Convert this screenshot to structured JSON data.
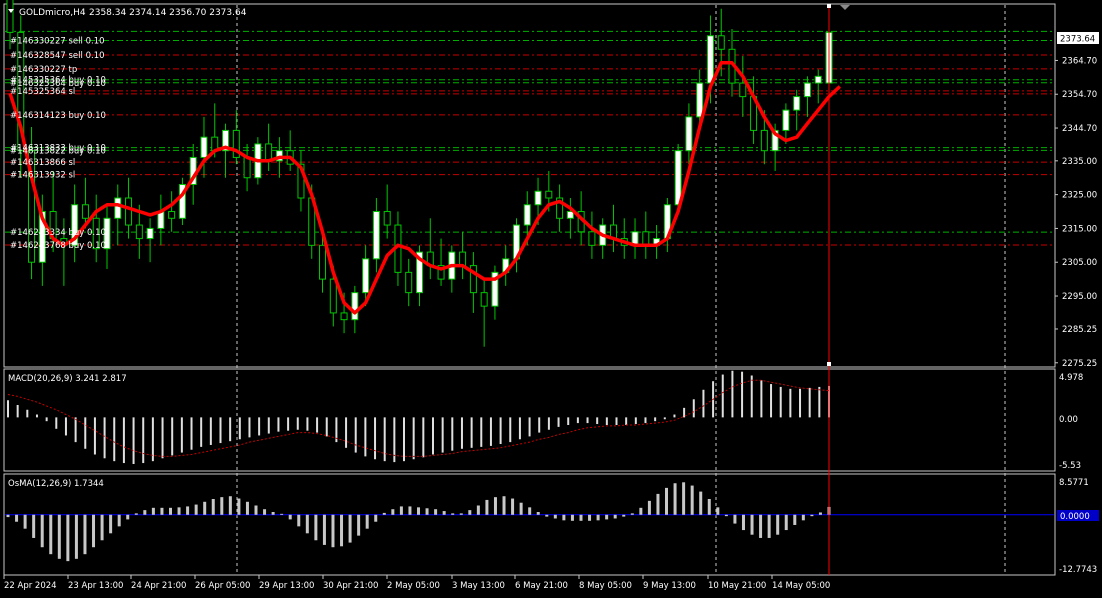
{
  "window": {
    "symbol_title": "GOLDmicro,H4",
    "ohlc": "2358.34 2374.14 2356.70 2373.64",
    "current_price_label": "2373.64",
    "colors": {
      "background": "#000000",
      "frame": "#c8c8c8",
      "grid": "#c8c8c8",
      "candle_bull": "#00c800",
      "candle_bull_body": "#ffffff",
      "candle_bear": "#00c800",
      "candle_bear_body": "#000000",
      "ma_line": "#ff0000",
      "sell_line": "#00b000",
      "buy_line": "#c80000",
      "macd_hist": "#e0e0e0",
      "macd_signal": "#c80000",
      "osma_hist": "#c8c8c8",
      "zero_line": "#0000ff",
      "current_time": "#ff0000"
    }
  },
  "price_axis": {
    "labels": [
      "2364.70",
      "2354.70",
      "2344.70",
      "2335.00",
      "2325.00",
      "2315.00",
      "2305.00",
      "2295.00",
      "2285.25",
      "2275.25"
    ],
    "values": [
      2364.7,
      2354.7,
      2344.7,
      2335.0,
      2325.0,
      2315.0,
      2305.0,
      2295.0,
      2285.25,
      2275.25
    ]
  },
  "time_axis": {
    "labels": [
      "22 Apr 2024",
      "23 Apr 13:00",
      "24 Apr 21:00",
      "26 Apr 05:00",
      "29 Apr 13:00",
      "30 Apr 21:00",
      "2 May 05:00",
      "3 May 13:00",
      "6 May 21:00",
      "8 May 05:00",
      "9 May 13:00",
      "10 May 21:00",
      "14 May 05:00"
    ]
  },
  "order_labels": [
    {
      "text": "#146330227 sell 0.10",
      "price": 2370.6
    },
    {
      "text": "#146328547 sell 0.10",
      "price": 2366.3
    },
    {
      "text": "#146330227 tp",
      "price": 2362.2
    },
    {
      "text": "#145325364 buy 0.10",
      "price": 2359.0
    },
    {
      "text": "#146325364 buy 0.10",
      "price": 2358.1
    },
    {
      "text": "#145325364 sl",
      "price": 2355.7
    },
    {
      "text": "#146314123 buy 0.10",
      "price": 2348.6
    },
    {
      "text": "#146313833 buy 0.10",
      "price": 2338.9
    },
    {
      "text": "#146313822 buy 0.10",
      "price": 2338.1
    },
    {
      "text": "#146313866 sl",
      "price": 2334.6
    },
    {
      "text": "#146313932 sl",
      "price": 2330.9
    },
    {
      "text": "#146243334 buy 0.10",
      "price": 2313.9
    },
    {
      "text": "#146243768 buy 0.10",
      "price": 2310.1
    }
  ],
  "order_lines": [
    {
      "price": 2373.3,
      "kind": "sell"
    },
    {
      "price": 2370.6,
      "kind": "sell"
    },
    {
      "price": 2366.3,
      "kind": "buy"
    },
    {
      "price": 2362.2,
      "kind": "buy"
    },
    {
      "price": 2359.0,
      "kind": "sell"
    },
    {
      "price": 2358.1,
      "kind": "sell"
    },
    {
      "price": 2355.7,
      "kind": "buy"
    },
    {
      "price": 2354.8,
      "kind": "buy"
    },
    {
      "price": 2348.6,
      "kind": "buy"
    },
    {
      "price": 2338.9,
      "kind": "sell"
    },
    {
      "price": 2338.1,
      "kind": "sell"
    },
    {
      "price": 2334.6,
      "kind": "buy"
    },
    {
      "price": 2330.9,
      "kind": "buy"
    },
    {
      "price": 2313.9,
      "kind": "sell"
    },
    {
      "price": 2310.1,
      "kind": "buy"
    }
  ],
  "macd_panel": {
    "title": "MACD(20,26,9) 3.241 2.817",
    "axis_labels": [
      "4.978",
      "0.00",
      "-5.53"
    ],
    "axis_values": [
      4.978,
      0.0,
      -5.53
    ],
    "hist": [
      1.8,
      1.3,
      0.8,
      0.3,
      -0.4,
      -1.2,
      -1.9,
      -2.6,
      -3.3,
      -3.9,
      -4.3,
      -4.6,
      -4.8,
      -4.9,
      -4.8,
      -4.6,
      -4.3,
      -4.0,
      -3.7,
      -3.4,
      -3.1,
      -2.9,
      -2.7,
      -2.5,
      -2.3,
      -2.1,
      -1.9,
      -1.7,
      -1.5,
      -1.4,
      -1.3,
      -1.4,
      -1.6,
      -2.0,
      -2.6,
      -3.2,
      -3.7,
      -4.1,
      -4.4,
      -4.6,
      -4.7,
      -4.6,
      -4.4,
      -4.2,
      -3.9,
      -3.7,
      -3.5,
      -3.3,
      -3.2,
      -3.1,
      -3.0,
      -2.8,
      -2.6,
      -2.3,
      -2.0,
      -1.6,
      -1.3,
      -1.0,
      -0.8,
      -0.6,
      -0.6,
      -0.7,
      -0.8,
      -0.8,
      -0.8,
      -0.7,
      -0.6,
      -0.4,
      -0.2,
      0.3,
      1.0,
      1.9,
      2.9,
      3.8,
      4.5,
      4.9,
      4.8,
      4.4,
      3.9,
      3.5,
      3.2,
      3.0,
      3.0,
      3.1,
      3.2,
      3.3
    ],
    "signal": [
      2.4,
      2.2,
      1.9,
      1.6,
      1.2,
      0.8,
      0.3,
      -0.2,
      -0.8,
      -1.4,
      -2.0,
      -2.6,
      -3.1,
      -3.5,
      -3.8,
      -4.0,
      -4.1,
      -4.1,
      -4.0,
      -3.9,
      -3.7,
      -3.5,
      -3.3,
      -3.1,
      -2.9,
      -2.6,
      -2.4,
      -2.2,
      -2.0,
      -1.8,
      -1.6,
      -1.6,
      -1.7,
      -1.9,
      -2.2,
      -2.5,
      -2.9,
      -3.2,
      -3.5,
      -3.8,
      -4.0,
      -4.1,
      -4.1,
      -4.1,
      -4.0,
      -3.9,
      -3.8,
      -3.6,
      -3.5,
      -3.4,
      -3.3,
      -3.2,
      -3.0,
      -2.8,
      -2.6,
      -2.3,
      -2.1,
      -1.8,
      -1.6,
      -1.3,
      -1.1,
      -1.0,
      -0.9,
      -0.9,
      -0.8,
      -0.8,
      -0.7,
      -0.6,
      -0.5,
      -0.3,
      0.1,
      0.6,
      1.2,
      1.9,
      2.6,
      3.2,
      3.6,
      3.9,
      3.9,
      3.7,
      3.5,
      3.3,
      3.1,
      3.0,
      2.9,
      2.8
    ]
  },
  "osma_panel": {
    "title": "OsMA(12,26,9) 1.7344",
    "axis_labels": [
      "8.5771",
      "0.0000",
      "-12.7743"
    ],
    "axis_values": [
      8.5771,
      0.0,
      -12.7743
    ],
    "hist": [
      -0.5,
      -1.5,
      -3.0,
      -5.0,
      -7.0,
      -8.5,
      -9.5,
      -10.0,
      -9.5,
      -8.5,
      -7.0,
      -5.5,
      -4.0,
      -2.5,
      -1.0,
      0.3,
      1.0,
      1.5,
      1.5,
      1.5,
      1.6,
      1.8,
      2.2,
      2.8,
      3.4,
      3.8,
      4.0,
      3.5,
      2.8,
      2.0,
      1.2,
      0.6,
      0.2,
      -1.0,
      -2.5,
      -4.0,
      -5.5,
      -6.5,
      -7.0,
      -6.8,
      -6.0,
      -4.5,
      -3.0,
      -1.5,
      0.4,
      1.2,
      1.8,
      1.8,
      1.6,
      1.4,
      1.2,
      0.8,
      0.3,
      0.3,
      1.0,
      2.0,
      3.2,
      3.8,
      4.0,
      3.5,
      2.6,
      1.6,
      0.6,
      -0.4,
      -0.8,
      -1.2,
      -1.3,
      -1.3,
      -1.3,
      -1.2,
      -1.0,
      -0.8,
      -0.4,
      0.3,
      1.5,
      3.0,
      4.5,
      5.8,
      6.8,
      7.0,
      6.3,
      5.0,
      3.4,
      1.6,
      -0.3,
      -1.9,
      -3.3,
      -4.3,
      -5.0,
      -5.0,
      -4.3,
      -3.3,
      -2.2,
      -1.2,
      -0.3,
      0.5,
      1.7
    ]
  },
  "candles": [
    [
      2386,
      2395,
      2368,
      2373
    ],
    [
      2373,
      2378,
      2330,
      2338
    ],
    [
      2338,
      2345,
      2300,
      2305
    ],
    [
      2305,
      2325,
      2298,
      2320
    ],
    [
      2320,
      2332,
      2308,
      2312
    ],
    [
      2312,
      2318,
      2298,
      2310
    ],
    [
      2310,
      2328,
      2305,
      2322
    ],
    [
      2322,
      2330,
      2315,
      2318
    ],
    [
      2318,
      2325,
      2305,
      2309
    ],
    [
      2309,
      2322,
      2303,
      2318
    ],
    [
      2318,
      2328,
      2310,
      2324
    ],
    [
      2324,
      2330,
      2312,
      2316
    ],
    [
      2316,
      2322,
      2306,
      2312
    ],
    [
      2312,
      2318,
      2305,
      2315
    ],
    [
      2315,
      2325,
      2310,
      2320
    ],
    [
      2320,
      2326,
      2314,
      2318
    ],
    [
      2318,
      2330,
      2316,
      2328
    ],
    [
      2328,
      2340,
      2322,
      2336
    ],
    [
      2336,
      2348,
      2330,
      2342
    ],
    [
      2342,
      2352,
      2336,
      2338
    ],
    [
      2338,
      2346,
      2330,
      2344
    ],
    [
      2344,
      2350,
      2334,
      2336
    ],
    [
      2336,
      2340,
      2326,
      2330
    ],
    [
      2330,
      2342,
      2328,
      2340
    ],
    [
      2340,
      2346,
      2332,
      2335
    ],
    [
      2335,
      2342,
      2330,
      2338
    ],
    [
      2338,
      2344,
      2332,
      2334
    ],
    [
      2334,
      2338,
      2320,
      2324
    ],
    [
      2324,
      2328,
      2306,
      2310
    ],
    [
      2310,
      2314,
      2296,
      2300
    ],
    [
      2300,
      2304,
      2286,
      2290
    ],
    [
      2290,
      2296,
      2284,
      2288
    ],
    [
      2288,
      2298,
      2284,
      2296
    ],
    [
      2296,
      2310,
      2292,
      2306
    ],
    [
      2306,
      2324,
      2302,
      2320
    ],
    [
      2320,
      2328,
      2312,
      2316
    ],
    [
      2316,
      2320,
      2298,
      2302
    ],
    [
      2302,
      2306,
      2292,
      2296
    ],
    [
      2296,
      2310,
      2292,
      2308
    ],
    [
      2308,
      2318,
      2300,
      2304
    ],
    [
      2304,
      2312,
      2298,
      2300
    ],
    [
      2300,
      2310,
      2296,
      2308
    ],
    [
      2308,
      2314,
      2300,
      2304
    ],
    [
      2304,
      2308,
      2290,
      2296
    ],
    [
      2296,
      2300,
      2280,
      2292
    ],
    [
      2292,
      2304,
      2288,
      2302
    ],
    [
      2302,
      2310,
      2298,
      2306
    ],
    [
      2306,
      2318,
      2302,
      2316
    ],
    [
      2316,
      2326,
      2310,
      2322
    ],
    [
      2322,
      2330,
      2316,
      2326
    ],
    [
      2326,
      2332,
      2320,
      2324
    ],
    [
      2324,
      2328,
      2314,
      2318
    ],
    [
      2318,
      2324,
      2312,
      2320
    ],
    [
      2320,
      2326,
      2310,
      2314
    ],
    [
      2314,
      2320,
      2306,
      2310
    ],
    [
      2310,
      2318,
      2306,
      2316
    ],
    [
      2316,
      2322,
      2308,
      2312
    ],
    [
      2312,
      2318,
      2306,
      2310
    ],
    [
      2310,
      2318,
      2306,
      2314
    ],
    [
      2314,
      2320,
      2306,
      2310
    ],
    [
      2310,
      2316,
      2306,
      2312
    ],
    [
      2312,
      2324,
      2308,
      2322
    ],
    [
      2322,
      2340,
      2320,
      2338
    ],
    [
      2338,
      2352,
      2334,
      2348
    ],
    [
      2348,
      2362,
      2344,
      2358
    ],
    [
      2358,
      2378,
      2352,
      2372
    ],
    [
      2372,
      2380,
      2360,
      2368
    ],
    [
      2368,
      2374,
      2354,
      2358
    ],
    [
      2358,
      2366,
      2348,
      2354
    ],
    [
      2354,
      2360,
      2340,
      2344
    ],
    [
      2344,
      2350,
      2334,
      2338
    ],
    [
      2338,
      2346,
      2332,
      2344
    ],
    [
      2344,
      2352,
      2340,
      2350
    ],
    [
      2350,
      2356,
      2344,
      2354
    ],
    [
      2354,
      2360,
      2348,
      2358
    ],
    [
      2358,
      2362,
      2352,
      2360
    ],
    [
      2358,
      2374,
      2356,
      2373
    ]
  ],
  "ma": [
    2355,
    2345,
    2330,
    2318,
    2312,
    2310,
    2312,
    2316,
    2320,
    2322,
    2322,
    2321,
    2320,
    2319,
    2320,
    2322,
    2325,
    2330,
    2335,
    2338,
    2339,
    2338,
    2336,
    2335,
    2335,
    2336,
    2336,
    2333,
    2325,
    2314,
    2302,
    2293,
    2290,
    2293,
    2300,
    2307,
    2310,
    2309,
    2306,
    2304,
    2303,
    2304,
    2304,
    2302,
    2300,
    2300,
    2302,
    2306,
    2312,
    2318,
    2322,
    2323,
    2321,
    2318,
    2315,
    2313,
    2312,
    2311,
    2310,
    2310,
    2310,
    2312,
    2320,
    2332,
    2345,
    2357,
    2364,
    2364,
    2360,
    2354,
    2348,
    2343,
    2341,
    2342,
    2346,
    2350,
    2354,
    2357
  ]
}
